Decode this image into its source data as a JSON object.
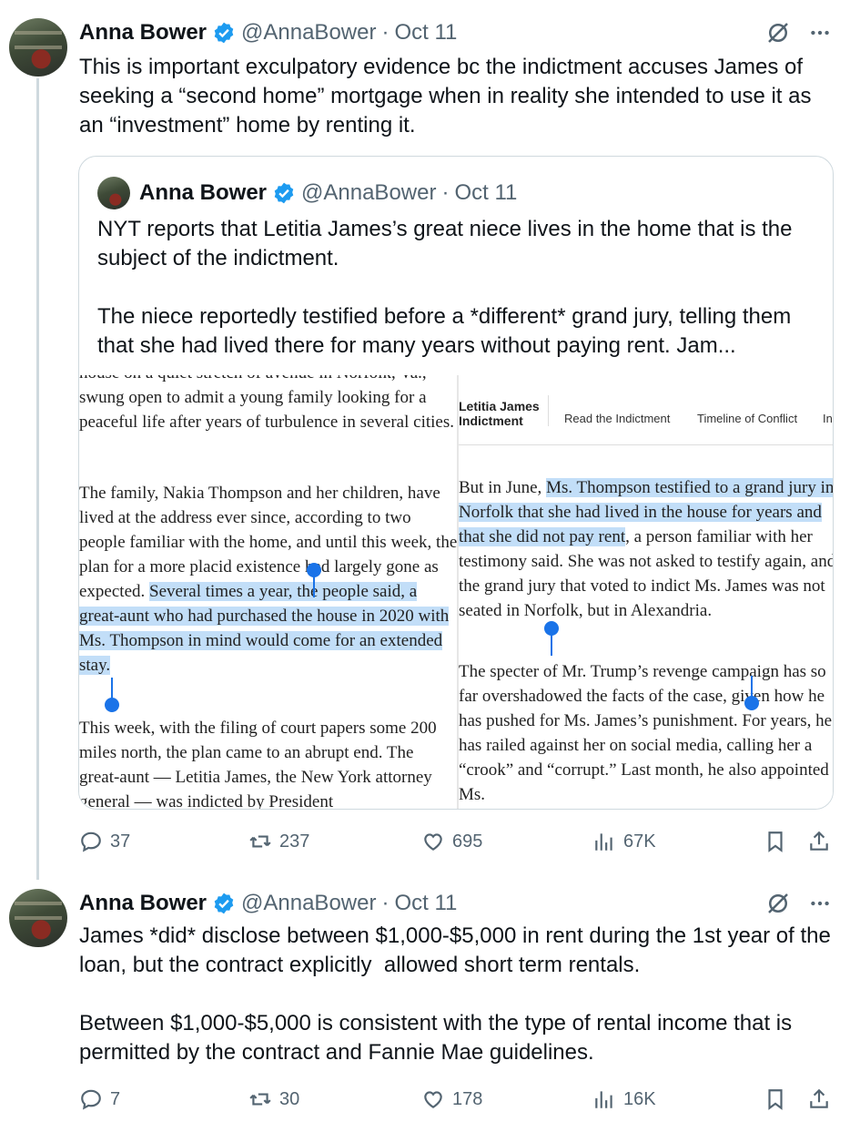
{
  "tweets": [
    {
      "author": "Anna Bower",
      "handle": "@AnnaBower",
      "separator": "·",
      "date": "Oct 11",
      "text": "This is important exculpatory evidence bc the indictment accuses James of seeking a “second home” mortgage when in reality she intended to use it as an “investment” home by renting it.",
      "quote": {
        "author": "Anna Bower",
        "handle": "@AnnaBower",
        "separator": "·",
        "date": "Oct 11",
        "text": "NYT reports that Letitia James’s great niece lives in the home that is the subject of the indictment.\n\nThe niece reportedly testified before a *different* grand jury, telling them that she had lived there for many years without paying rent. Jam...",
        "media": {
          "left": {
            "p1": "house on a quiet stretch of avenue in Norfolk, Va., swung open to admit a young family looking for a peaceful life after years of turbulence in several cities.",
            "p2_plain": "The family, Nakia Thompson and her children, have lived at the address ever since, according to two people familiar with the home, and until this week, the plan for a more placid existence had largely gone as expected. ",
            "p2_highlight": "Several times a year, the people said, a great-aunt who had purchased the house in 2020 with Ms. Thompson in mind would come for an extended stay.",
            "p3": "This week, with the filing of court papers some 200 miles north, the plan came to an abrupt end. The great-aunt — Letitia James, the New York attorney general — was indicted by President"
          },
          "right": {
            "brand_line1": "Letitia James",
            "brand_line2": "Indictment",
            "nav": [
              "Read the Indictment",
              "Timeline of Conflict",
              "In"
            ],
            "p1_lead": "But in June, ",
            "p1_highlight": "Ms. Thompson testified to a grand jury in Norfolk that she had lived in the house for years and that she did not pay rent",
            "p1_rest": ", a person familiar with her testimony said. She was not asked to testify again, and the grand jury that voted to indict Ms. James was not seated in Norfolk, but in Alexandria.",
            "p2": "The specter of Mr. Trump’s revenge campaign has so far overshadowed the facts of the case, given how he has pushed for Ms. James’s punishment. For years, he has railed against her on social media, calling her a “crook” and “corrupt.” Last month, he also appointed Ms."
          }
        }
      },
      "metrics": {
        "replies": "37",
        "reposts": "237",
        "likes": "695",
        "views": "67K"
      }
    },
    {
      "author": "Anna Bower",
      "handle": "@AnnaBower",
      "separator": "·",
      "date": "Oct 11",
      "text": "James *did* disclose between $1,000-$5,000 in rent during the 1st year of the loan, but the contract explicitly  allowed short term rentals.\n\nBetween $1,000-$5,000 is consistent with the type of rental income that is permitted by the contract and Fannie Mae guidelines.",
      "metrics": {
        "replies": "7",
        "reposts": "30",
        "likes": "178",
        "views": "16K"
      }
    }
  ],
  "colors": {
    "verified": "#1d9bf0",
    "muted": "#536471",
    "highlight": "#c2def8",
    "selection_handle": "#1a73e8"
  },
  "icons": [
    "verified-badge-icon",
    "grok-icon",
    "more-icon",
    "reply-icon",
    "repost-icon",
    "like-icon",
    "views-icon",
    "bookmark-icon",
    "share-icon"
  ]
}
